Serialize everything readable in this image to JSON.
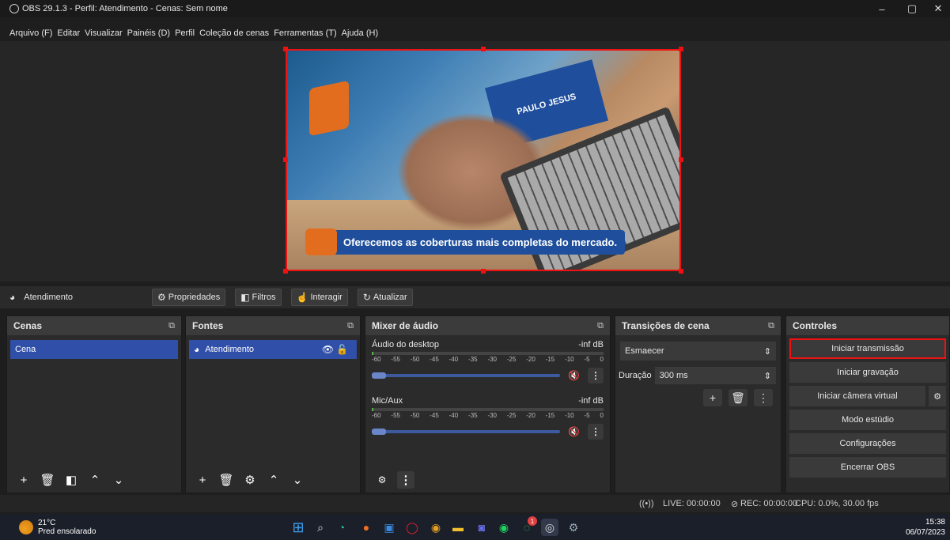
{
  "window": {
    "title": "OBS 29.1.3 - Perfil: Atendimento - Cenas: Sem nome",
    "minimize": "–",
    "restore": "▢",
    "close": "✕"
  },
  "menu": [
    "Arquivo (F)",
    "Editar",
    "Visualizar",
    "Painéis (D)",
    "Perfil",
    "Coleção de cenas",
    "Ferramentas (T)",
    "Ajuda (H)"
  ],
  "preview": {
    "card_text": "PAULO JESUS",
    "caption": "Oferecemos as coberturas mais completas do mercado."
  },
  "source_bar": {
    "source_name": "Atendimento",
    "properties": "Propriedades",
    "filters": "Filtros",
    "interact": "Interagir",
    "refresh": "Atualizar"
  },
  "docks": {
    "scenes": {
      "title": "Cenas",
      "items": [
        "Cena"
      ]
    },
    "sources": {
      "title": "Fontes",
      "items": [
        "Atendimento"
      ]
    },
    "mixer": {
      "title": "Mixer de áudio",
      "tracks": [
        {
          "name": "Áudio do desktop",
          "level": "-inf dB"
        },
        {
          "name": "Mic/Aux",
          "level": "-inf dB"
        }
      ],
      "scale": [
        "-60",
        "-55",
        "-50",
        "-45",
        "-40",
        "-35",
        "-30",
        "-25",
        "-20",
        "-15",
        "-10",
        "-5",
        "0"
      ]
    },
    "transitions": {
      "title": "Transições de cena",
      "selected": "Esmaecer",
      "duration_label": "Duração",
      "duration_value": "300 ms"
    },
    "controls": {
      "title": "Controles",
      "buttons": [
        "Iniciar transmissão",
        "Iniciar gravação",
        "Iniciar câmera virtual",
        "Modo estúdio",
        "Configurações",
        "Encerrar OBS"
      ]
    }
  },
  "status": {
    "live": "LIVE: 00:00:00",
    "rec": "REC: 00:00:00",
    "cpu": "CPU: 0.0%, 30.00 fps"
  },
  "taskbar": {
    "temp": "21°C",
    "weather": "Pred ensolarado",
    "time": "15:38",
    "date": "06/07/2023",
    "badge": "1"
  },
  "colors": {
    "accent": "#2f4fa8",
    "selection": "#e11111",
    "background": "#1e1e1e"
  }
}
